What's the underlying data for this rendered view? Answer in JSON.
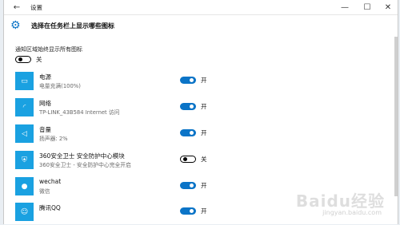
{
  "window": {
    "title": "设置",
    "back": "←",
    "minimize": "—",
    "maximize": "☐",
    "close": "✕"
  },
  "header": {
    "title": "选择在任务栏上显示哪些图标",
    "icon": "gear-icon"
  },
  "always_show": {
    "label": "通知区域始终显示所有图标",
    "state_label": "关",
    "state": "off"
  },
  "items": [
    {
      "name": "电源",
      "sub": "电量充满(100%)",
      "state_label": "开",
      "state": "on",
      "icon": "battery-icon",
      "glyph": "▭"
    },
    {
      "name": "网络",
      "sub": "TP-LINK_43B584 Internet 访问",
      "state_label": "开",
      "state": "on",
      "icon": "wifi-icon",
      "glyph": "◜"
    },
    {
      "name": "音量",
      "sub": "扬声器: 2%",
      "state_label": "开",
      "state": "on",
      "icon": "speaker-icon",
      "glyph": "◁"
    },
    {
      "name": "360安全卫士 安全防护中心模块",
      "sub": "360安全卫士 - 安全防护中心完全开启",
      "state_label": "关",
      "state": "off",
      "icon": "shield-360-icon",
      "glyph": "⛨"
    },
    {
      "name": "wechat",
      "sub": "微信",
      "state_label": "开",
      "state": "on",
      "icon": "wechat-icon",
      "glyph": "●"
    },
    {
      "name": "腾讯QQ",
      "sub": "",
      "state_label": "开",
      "state": "on",
      "icon": "qq-icon",
      "glyph": "☺"
    }
  ],
  "watermark": {
    "text": "Baidu经验",
    "sub": "jingyan.baidu.com"
  },
  "colors": {
    "accent": "#0b74c7",
    "app_icon_bg": "#1aa1e1"
  }
}
